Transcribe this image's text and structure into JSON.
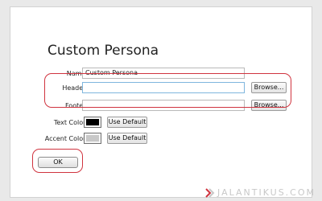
{
  "dialog": {
    "title": "Custom Persona"
  },
  "form": {
    "name_label": "Name:",
    "name_value": "Custom Persona",
    "header_label": "Header:",
    "header_value": "",
    "header_browse": "Browse...",
    "footer_label": "Footer:",
    "footer_value": "",
    "footer_browse": "Browse...",
    "text_color_label": "Text Color:",
    "text_color_value": "#000000",
    "text_color_default": "Use Default",
    "accent_color_label": "Accent Color:",
    "accent_color_value": "#c8c8c8",
    "accent_color_default": "Use Default"
  },
  "footer": {
    "ok_label": "OK"
  },
  "highlight_color": "#d0343f",
  "watermark": {
    "text": "JALANTIKUS.COM",
    "icon": "jalantikus-logo-icon"
  }
}
